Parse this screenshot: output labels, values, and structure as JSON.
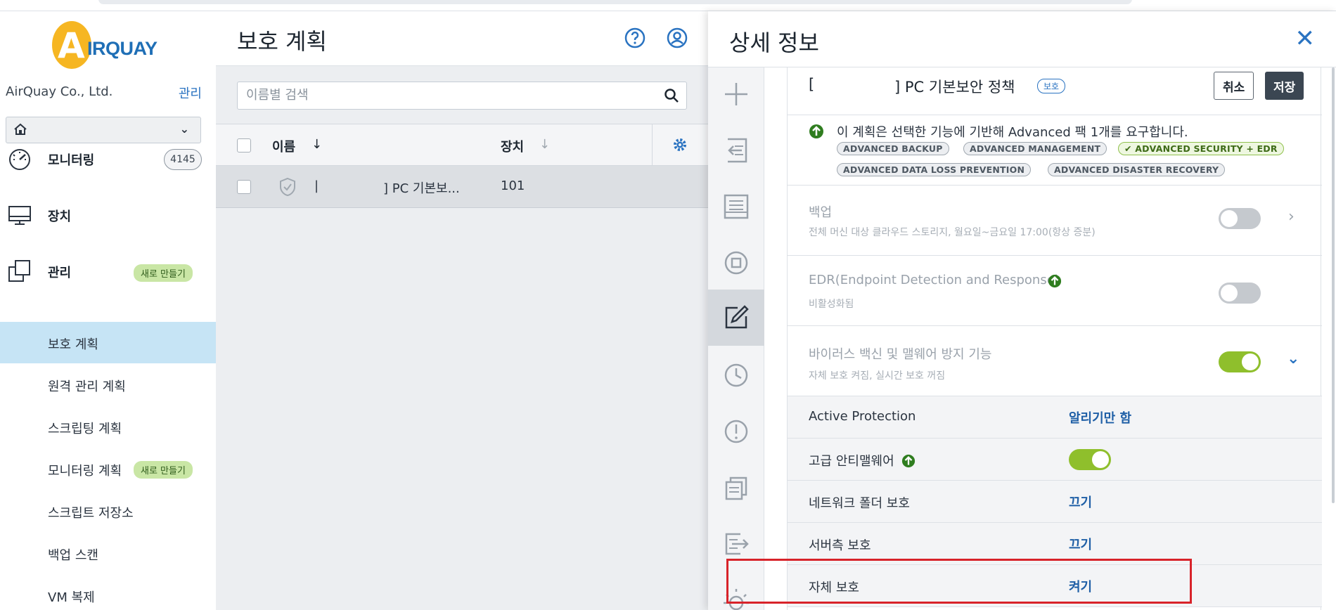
{
  "app": {
    "logo_text": "IRQUAY",
    "logo_letter": "A"
  },
  "sidebar": {
    "company": "AirQuay Co., Ltd.",
    "manage_link": "관리",
    "tenant_value": "",
    "main_items": [
      {
        "label": "모니터링",
        "badge": "4145"
      },
      {
        "label": "장치"
      },
      {
        "label": "관리",
        "badge_new": "새로 만들기"
      }
    ],
    "sub_items": [
      {
        "label": "보호 계획"
      },
      {
        "label": "원격 관리 계획"
      },
      {
        "label": "스크립팅 계획"
      },
      {
        "label": "모니터링 계획",
        "badge_new": "새로 만들기"
      },
      {
        "label": "스크립트 저장소"
      },
      {
        "label": "백업 스캔"
      },
      {
        "label": "VM 복제"
      }
    ]
  },
  "list": {
    "title": "보호 계획",
    "search_placeholder": "이름별 검색",
    "columns": {
      "name": "이름",
      "devices": "장치"
    },
    "rows": [
      {
        "name_prefix": "|",
        "name": "] PC 기본보...",
        "devices": "101"
      }
    ]
  },
  "details": {
    "title": "상세 정보",
    "plan_name_open": "[",
    "plan_name": "] PC 기본보안 정책",
    "plan_tag": "보호",
    "cancel_label": "취소",
    "save_label": "저장",
    "notice": "이 계획은 선택한 기능에 기반해 Advanced 팩 1개를 요구합니다.",
    "packs": [
      {
        "label": "ADVANCED BACKUP",
        "enabled": false
      },
      {
        "label": "ADVANCED MANAGEMENT",
        "enabled": false
      },
      {
        "label": "✔ ADVANCED SECURITY + EDR",
        "enabled": true
      },
      {
        "label": "ADVANCED DATA LOSS PREVENTION",
        "enabled": false
      },
      {
        "label": "ADVANCED DISASTER RECOVERY",
        "enabled": false
      }
    ],
    "features": [
      {
        "title": "백업",
        "subtitle": "전체 머신 대상 클라우드 스토리지, 월요일~금요일 17:00(항상 증분)",
        "enabled": false
      },
      {
        "title": "EDR(Endpoint Detection and Response)",
        "subtitle": "비활성화됨",
        "enabled": false
      },
      {
        "title": "바이러스 백신 및 맬웨어 방지 기능",
        "subtitle": "자체 보호 켜짐, 실시간 보호 꺼짐",
        "enabled": true
      }
    ],
    "settings": [
      {
        "label": "Active Protection",
        "value": "알리기만 함"
      },
      {
        "label": "고급 안티맬웨어",
        "value": "",
        "toggle_on": true
      },
      {
        "label": "네트워크 폴더 보호",
        "value": "끄기"
      },
      {
        "label": "서버측 보호",
        "value": "끄기"
      },
      {
        "label": "자체 보호",
        "value": "켜기"
      }
    ]
  },
  "colors": {
    "accent": "#2a73c1",
    "active_nav": "#c6e4f5",
    "toggle_on": "#8fbf2c",
    "highlight": "#d8232a",
    "logo": "#f6b622"
  }
}
